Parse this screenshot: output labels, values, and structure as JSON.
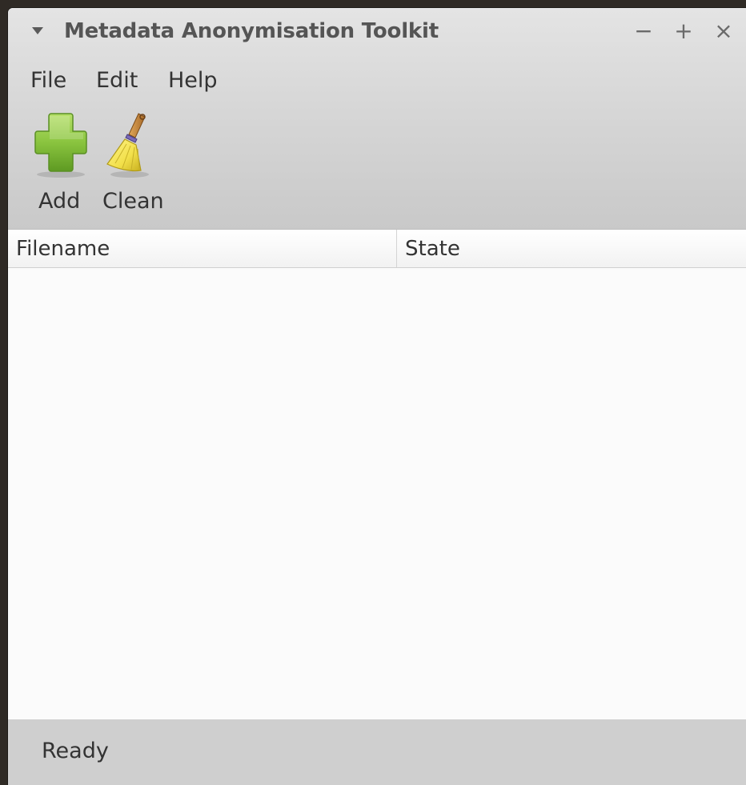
{
  "window": {
    "title": "Metadata Anonymisation Toolkit",
    "controls": {
      "minimize": "−",
      "maximize": "+",
      "close": "×"
    }
  },
  "menubar": {
    "items": [
      "File",
      "Edit",
      "Help"
    ]
  },
  "toolbar": {
    "add_label": "Add",
    "clean_label": "Clean",
    "add_icon": "plus-icon",
    "clean_icon": "broom-icon"
  },
  "file_list": {
    "columns": [
      "Filename",
      "State"
    ],
    "rows": []
  },
  "statusbar": {
    "text": "Ready"
  },
  "colors": {
    "add_icon_green": "#8ac43f",
    "broom_yellow": "#f2e04a",
    "chrome_gradient_top": "#e4e4e4",
    "chrome_gradient_bottom": "#c9c9c9",
    "statusbar_bg": "#cfcfcf"
  }
}
